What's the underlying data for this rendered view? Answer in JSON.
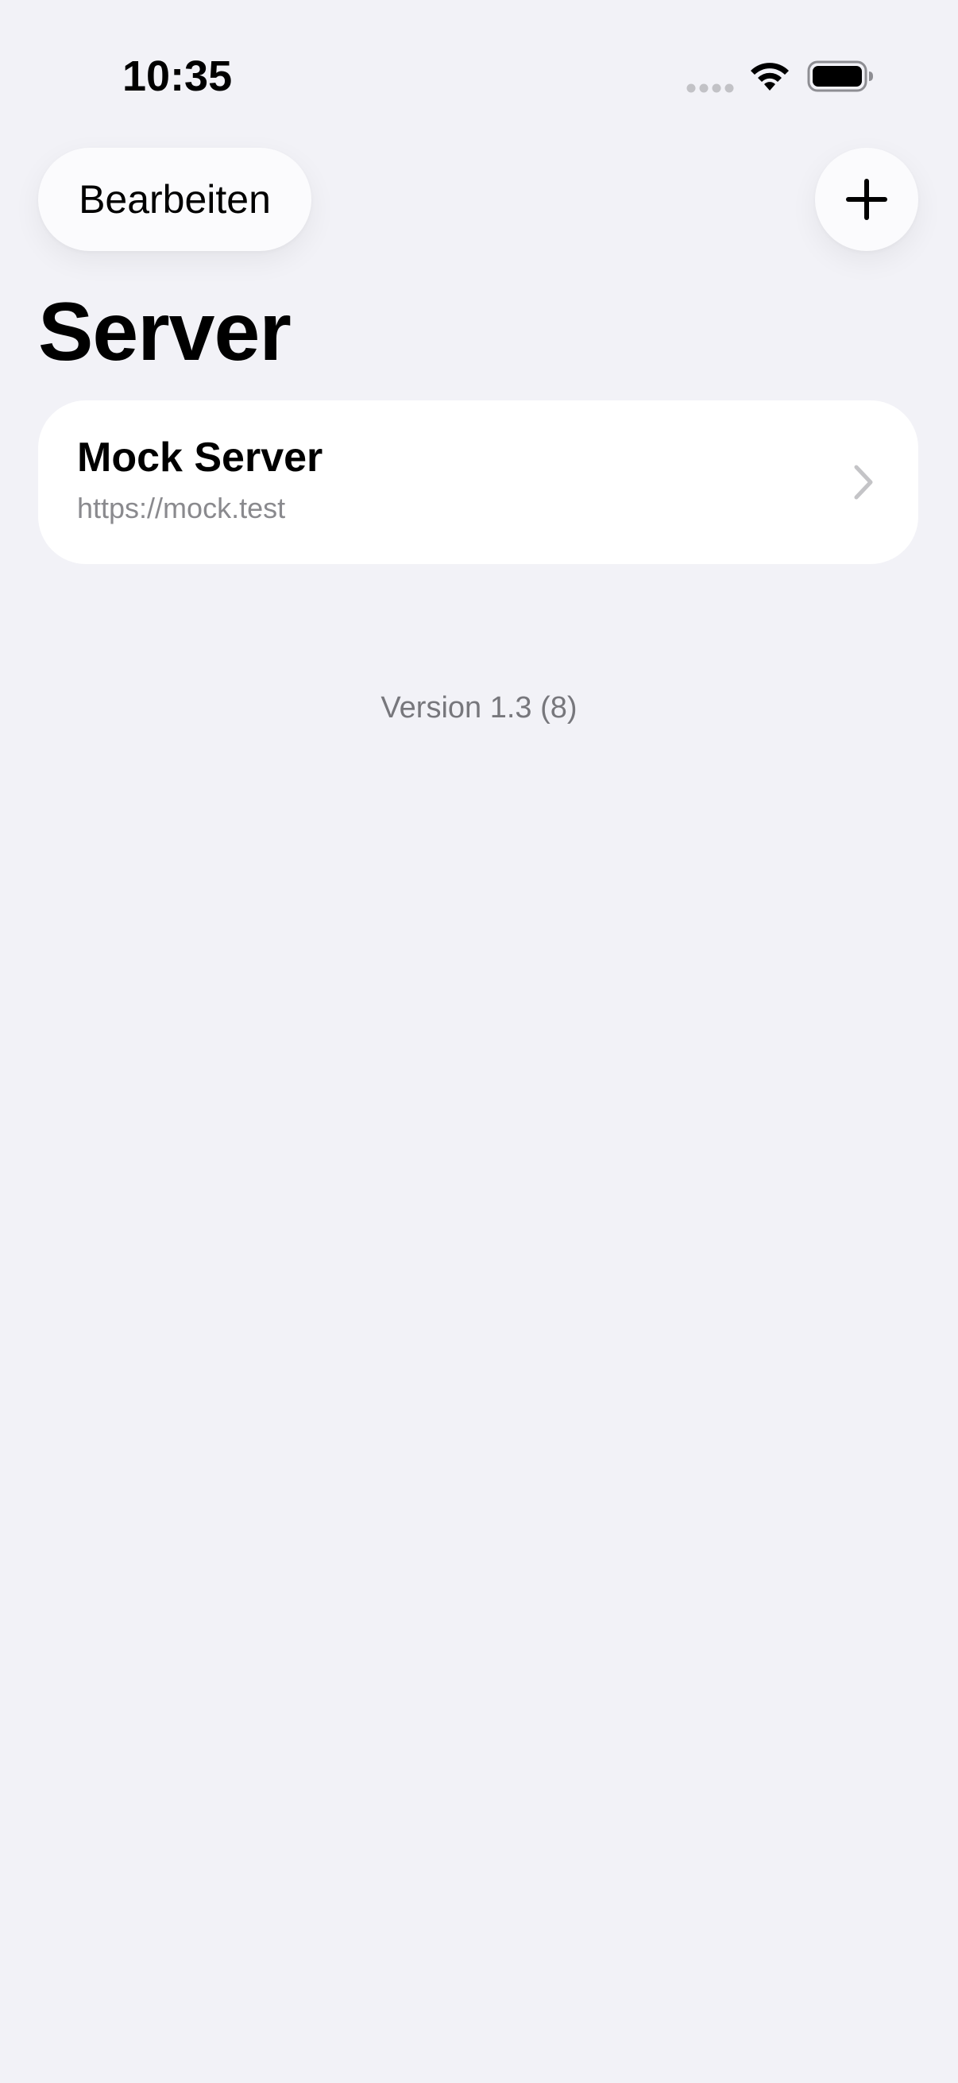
{
  "status_bar": {
    "time": "10:35"
  },
  "nav": {
    "edit_label": "Bearbeiten",
    "add_icon": "plus-icon"
  },
  "page": {
    "title": "Server"
  },
  "servers": [
    {
      "name": "Mock Server",
      "url": "https://mock.test"
    }
  ],
  "footer": {
    "version": "Version 1.3 (8)"
  },
  "colors": {
    "background": "#f2f2f7",
    "card": "#ffffff",
    "secondary_text": "#8a8a8e",
    "chevron": "#c4c4c7"
  }
}
